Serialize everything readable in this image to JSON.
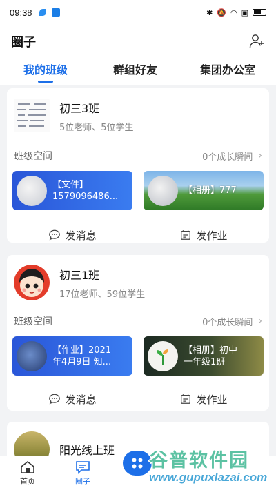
{
  "status_bar": {
    "time": "09:38"
  },
  "header": {
    "title": "圈子"
  },
  "tabs": [
    {
      "label": "我的班级",
      "active": true
    },
    {
      "label": "群组好友",
      "active": false
    },
    {
      "label": "集团办公室",
      "active": false
    }
  ],
  "classes": [
    {
      "name": "初三3班",
      "meta": "5位老师、5位学生",
      "space_label": "班级空间",
      "moments": "0个成长瞬间",
      "tiles": [
        {
          "text": "【文件】 1579096486...",
          "line1": "【文件】",
          "line2": "1579096486..."
        },
        {
          "text": "【相册】777",
          "line1": "【相册】777",
          "line2": ""
        }
      ],
      "actions": {
        "message": "发消息",
        "homework": "发作业"
      }
    },
    {
      "name": "初三1班",
      "meta": "17位老师、59位学生",
      "space_label": "班级空间",
      "moments": "0个成长瞬间",
      "tiles": [
        {
          "line1": "【作业】2021",
          "line2": "年4月9日 知..."
        },
        {
          "line1": "【相册】初中",
          "line2": "一年级1班"
        }
      ],
      "actions": {
        "message": "发消息",
        "homework": "发作业"
      }
    },
    {
      "name": "阳光线上班"
    }
  ],
  "bottom_nav": [
    {
      "label": "首页",
      "active": false
    },
    {
      "label": "圈子",
      "active": true
    }
  ],
  "watermark": {
    "brand": "谷普软件园",
    "url": "www.gupuxlazai.com"
  },
  "colors": {
    "accent": "#1d6fe8",
    "tile_blue": "#2b5fe0",
    "watermark_green": "#5cc2a3"
  }
}
